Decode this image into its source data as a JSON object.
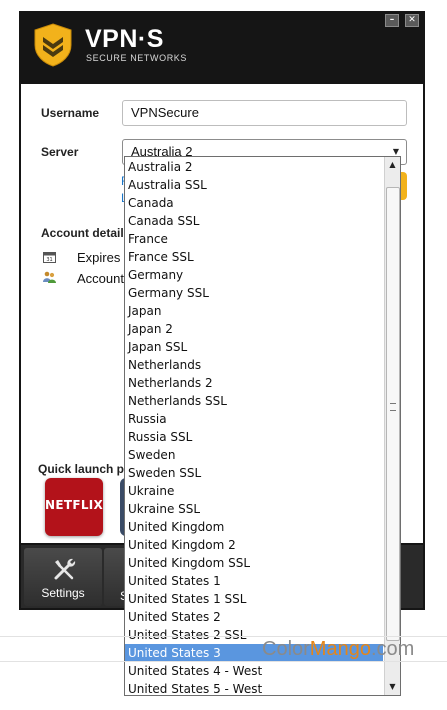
{
  "app": {
    "brand": "VPN·S",
    "tagline": "SECURE NETWORKS"
  },
  "window_controls": {
    "minimize": "–",
    "close": "✕"
  },
  "form": {
    "username_label": "Username",
    "username_value": "VPNSecure",
    "server_label": "Server",
    "server_value": "Australia 2"
  },
  "account": {
    "heading": "Account details",
    "expires_label": "Expires",
    "account_label": "Account"
  },
  "quick_launch": {
    "heading": "Quick launch po",
    "netflix_label": "NETFLIX"
  },
  "toolbar": {
    "settings_label": "Settings",
    "partial_label": "S"
  },
  "server_list": [
    "Australia 2",
    "Australia SSL",
    "Canada",
    "Canada SSL",
    "France",
    "France SSL",
    "Germany",
    "Germany SSL",
    "Japan",
    "Japan 2",
    "Japan SSL",
    "Netherlands",
    "Netherlands 2",
    "Netherlands SSL",
    "Russia",
    "Russia SSL",
    "Sweden",
    "Sweden SSL",
    "Ukraine",
    "Ukraine SSL",
    "United Kingdom",
    "United Kingdom 2",
    "United Kingdom SSL",
    "United States 1",
    "United States 1 SSL",
    "United States 2",
    "United States 2 SSL",
    "United States 3",
    "United States 4 - West",
    "United States 5 - West"
  ],
  "highlighted_server": "United States 3",
  "watermark": {
    "a": "Color",
    "b": "Mango",
    "c": ".com"
  },
  "colors": {
    "accent_yellow": "#f2b21b",
    "selection_blue": "#5a96df",
    "link_blue": "#1b76c8"
  }
}
